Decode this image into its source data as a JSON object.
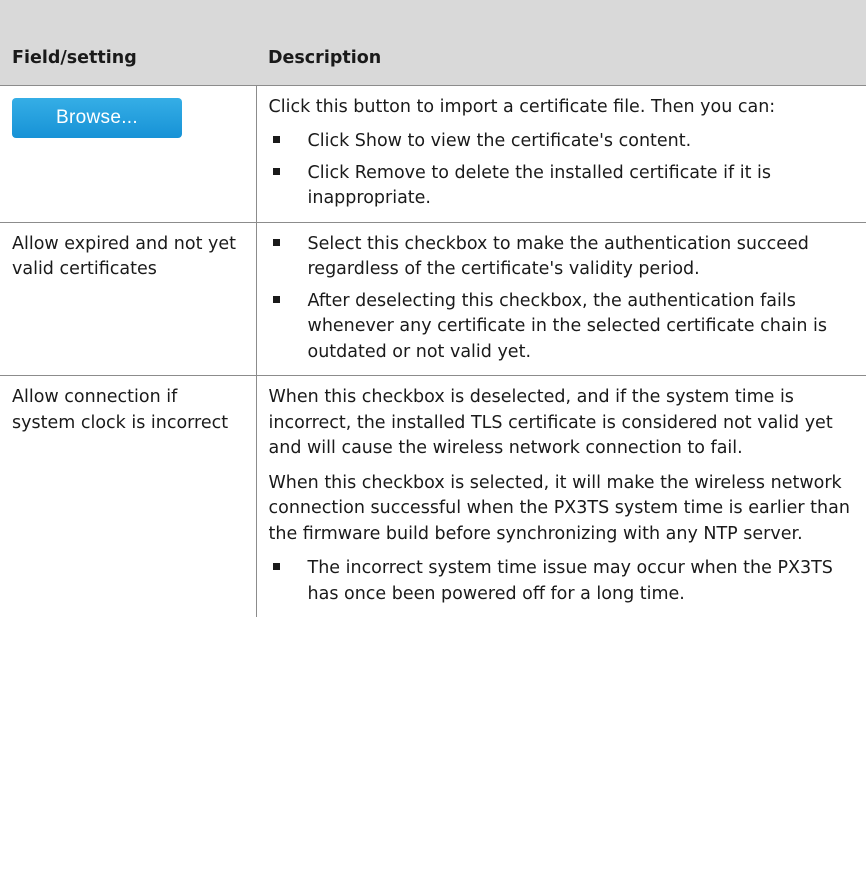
{
  "table": {
    "headers": {
      "field": "Field/setting",
      "description": "Description"
    },
    "rows": [
      {
        "field_button": "Browse...",
        "paragraphs": [
          "Click this button to import a certificate file. Then you can:"
        ],
        "bullets": [
          "Click Show to view the certificate's content.",
          "Click Remove to delete the installed certificate if it is inappropriate."
        ]
      },
      {
        "field": "Allow expired and not yet valid certificates",
        "bullets": [
          "Select this checkbox to make the authentication succeed regardless of the certificate's validity period.",
          "After deselecting this checkbox, the authentication fails whenever any certificate in the selected certificate chain is outdated or not valid yet."
        ]
      },
      {
        "field": "Allow connection if system clock is incorrect",
        "paragraphs": [
          "When this checkbox is deselected, and if the system time is incorrect, the installed TLS certificate is considered not valid yet and will cause the wireless network connection to fail.",
          "When this checkbox is selected, it will make the wireless network connection successful when the PX3TS system time is earlier than the firmware build before synchronizing with any NTP server."
        ],
        "bullets": [
          "The incorrect system time issue may occur when the PX3TS has once been powered off for a long time."
        ]
      }
    ]
  }
}
